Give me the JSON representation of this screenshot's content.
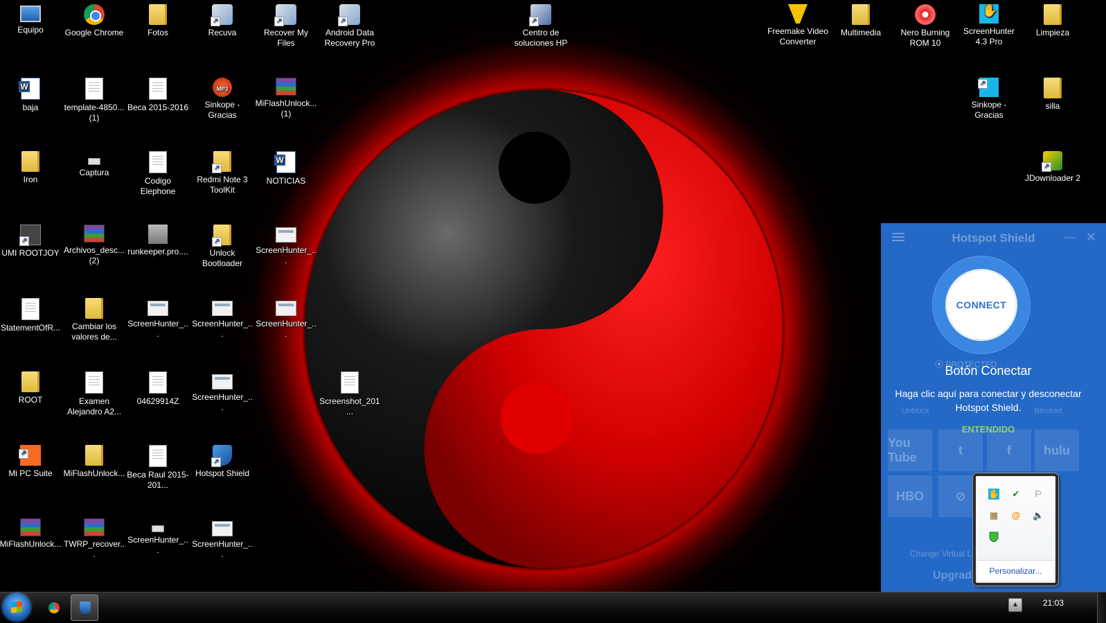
{
  "desktop": {
    "icons": [
      "Equipo",
      "Google Chrome",
      "Fotos",
      "Recuva",
      "Recover My Files",
      "Android Data Recovery Pro",
      "Centro de soluciones HP",
      "Freemake Video Converter",
      "Multimedia",
      "Nero Burning ROM 10",
      "ScreenHunter 4.3 Pro",
      "Limpieza",
      "baja",
      "template-4850... (1)",
      "Beca 2015-2016",
      "Sinkope - Gracias",
      "MiFlashUnlock... (1)",
      "Sinkope - Gracias",
      "silla",
      "Iron",
      "Captura",
      "Codigo Elephone",
      "Redmi Note 3 ToolKit",
      "NOTICIAS",
      "JDownloader 2",
      "UMI ROOTJOY",
      "Archivos_desc... (2)",
      "runkeeper.pro....",
      "Unlock Bootloader",
      "ScreenHunter_...",
      "StatementOfR...",
      "Cambiar los valores de...",
      "ScreenHunter_...",
      "ScreenHunter_...",
      "ScreenHunter_...",
      "ROOT",
      "Examen Alejandro A2...",
      "04629914Z",
      "ScreenHunter_...",
      "Screenshot_201...",
      "Mi PC Suite",
      "MiFlashUnlock...",
      "Beca Raul 2015-201...",
      "Hotspot Shield",
      "MiFlashUnlock...",
      "TWRP_recover...",
      "ScreenHunter_...",
      "ScreenHunter_..."
    ]
  },
  "hotspot_shield": {
    "title": "Hotspot Shield",
    "minimize": "—",
    "close": "✕",
    "connect_label": "CONNECT",
    "location_text": "⦿ PROTECTED",
    "unblock_text": "Unblock",
    "blocked_text": "Blocked",
    "tiles": [
      "You Tube",
      "t",
      "f",
      "hulu",
      "HBO",
      "⊘"
    ],
    "footer1": "Change Virtual Location",
    "footer2": "Upgrade",
    "tooltip": {
      "title": "Botón Conectar",
      "body_line1": "Haga clic aquí para conectar y desconectar",
      "body_line2": "Hotspot Shield.",
      "ok": "ENTENDIDO"
    }
  },
  "tray_overflow": {
    "customize": "Personalizar..."
  },
  "taskbar": {
    "clock": "21:03",
    "tray_arrow": "▲"
  }
}
